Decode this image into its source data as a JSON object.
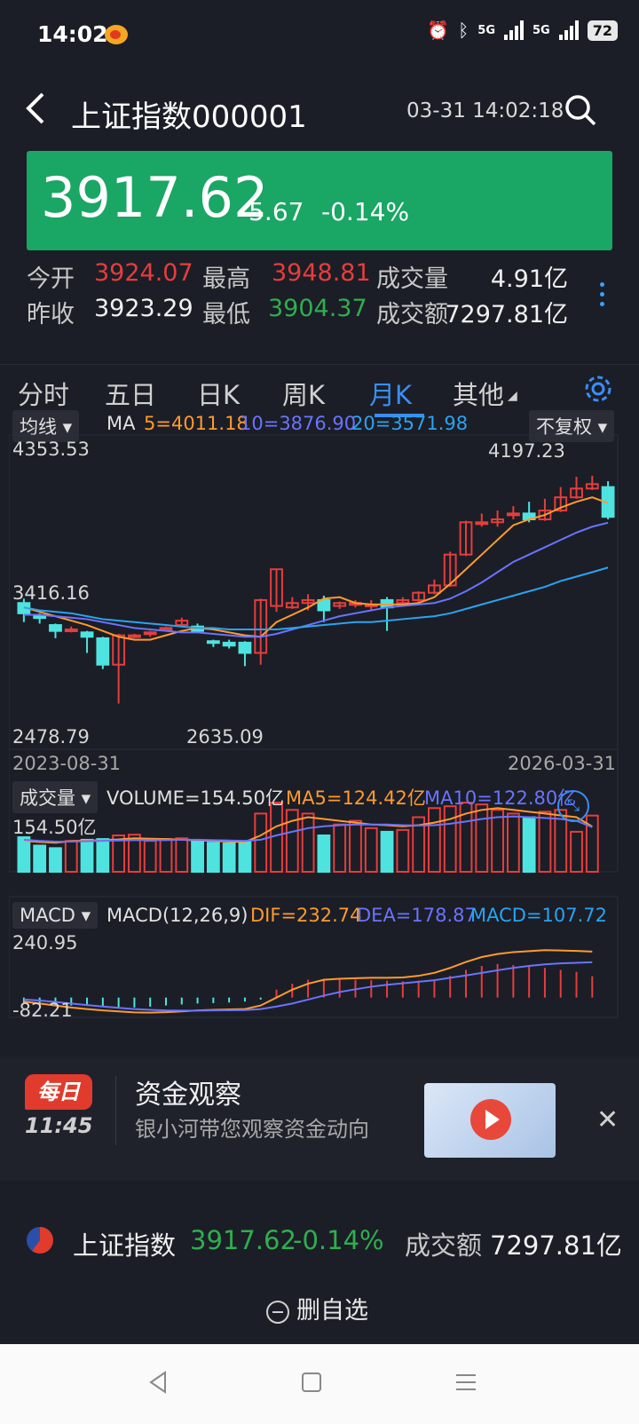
{
  "status": {
    "time": "14:02",
    "battery": "72",
    "net1": "5G",
    "net2": "5G"
  },
  "header": {
    "title": "上证指数000001",
    "datetime": "03-31 14:02:18"
  },
  "price": {
    "last": "3917.62",
    "change": "-5.67",
    "pct": "-0.14%"
  },
  "stats": {
    "open_label": "今开",
    "open": "3924.07",
    "high_label": "最高",
    "high": "3948.81",
    "vol_label": "成交量",
    "vol": "4.91亿",
    "prev_label": "昨收",
    "prev": "3923.29",
    "low_label": "最低",
    "low": "3904.37",
    "amt_label": "成交额",
    "amt": "7297.81亿"
  },
  "tabs": [
    "分时",
    "五日",
    "日K",
    "周K",
    "月K",
    "其他"
  ],
  "kline": {
    "ma_dropdown": "均线",
    "ma_label": "MA",
    "ma5": "5=4011.18",
    "ma10": "10=3876.90",
    "ma20": "20=3571.98",
    "adjust": "不复权",
    "y_top": "4353.53",
    "y_mid": "3416.16",
    "y_bot": "2478.79",
    "max_label": "4197.23",
    "min_label": "2635.09",
    "date_start": "2023-08-31",
    "date_end": "2026-03-31"
  },
  "volume": {
    "dropdown": "成交量",
    "volume": "VOLUME=154.50亿",
    "ma5": "MA5=124.42亿",
    "ma10": "MA10=122.80亿",
    "y_top": "154.50亿"
  },
  "macd": {
    "dropdown": "MACD",
    "params": "MACD(12,26,9)",
    "dif": "DIF=232.74",
    "dea": "DEA=178.87",
    "macd": "MACD=107.72",
    "y_top": "240.95",
    "y_bot": "-82.21"
  },
  "banner": {
    "badge": "每日",
    "time": "11:45",
    "title": "资金观察",
    "subtitle": "银小河带您观察资金动向"
  },
  "quote_bar": {
    "name": "上证指数",
    "price": "3917.62",
    "pct": "-0.14%",
    "amt_label": "成交额",
    "amt": "7297.81亿"
  },
  "action": {
    "label": "删自选"
  },
  "colors": {
    "up": "#e63d3d",
    "down": "#4fe3e0",
    "accent": "#3a8ef5",
    "price_box": "#1aa664",
    "ma5": "#ff9a2e",
    "ma10": "#6a73ff",
    "ma20": "#2ba3f2"
  },
  "chart_data": {
    "type": "candlestick",
    "y_range": [
      2478.79,
      4353.53
    ],
    "candles": [
      {
        "o": 3330,
        "c": 3260,
        "h": 3360,
        "l": 3200
      },
      {
        "o": 3240,
        "c": 3230,
        "h": 3260,
        "l": 3190
      },
      {
        "o": 3180,
        "c": 3140,
        "h": 3190,
        "l": 3090
      },
      {
        "o": 3150,
        "c": 3150,
        "h": 3170,
        "l": 3130
      },
      {
        "o": 3130,
        "c": 3100,
        "h": 3140,
        "l": 2990
      },
      {
        "o": 3090,
        "c": 2910,
        "h": 3100,
        "l": 2880
      },
      {
        "o": 2910,
        "c": 3110,
        "h": 3120,
        "l": 2645
      },
      {
        "o": 3100,
        "c": 3110,
        "h": 3120,
        "l": 3090
      },
      {
        "o": 3120,
        "c": 3130,
        "h": 3140,
        "l": 3100
      },
      {
        "o": 3150,
        "c": 3160,
        "h": 3170,
        "l": 3140
      },
      {
        "o": 3180,
        "c": 3210,
        "h": 3230,
        "l": 3170
      },
      {
        "o": 3170,
        "c": 3140,
        "h": 3190,
        "l": 3130
      },
      {
        "o": 3070,
        "c": 3060,
        "h": 3080,
        "l": 3030
      },
      {
        "o": 3060,
        "c": 3040,
        "h": 3080,
        "l": 3020
      },
      {
        "o": 3060,
        "c": 2990,
        "h": 3070,
        "l": 2900
      },
      {
        "o": 2990,
        "c": 3350,
        "h": 3360,
        "l": 2910
      },
      {
        "o": 3310,
        "c": 3560,
        "h": 3560,
        "l": 3270
      },
      {
        "o": 3300,
        "c": 3330,
        "h": 3370,
        "l": 3290
      },
      {
        "o": 3330,
        "c": 3350,
        "h": 3390,
        "l": 3280
      },
      {
        "o": 3350,
        "c": 3280,
        "h": 3380,
        "l": 3200
      },
      {
        "o": 3310,
        "c": 3330,
        "h": 3340,
        "l": 3290
      },
      {
        "o": 3330,
        "c": 3330,
        "h": 3350,
        "l": 3300
      },
      {
        "o": 3320,
        "c": 3320,
        "h": 3350,
        "l": 3280
      },
      {
        "o": 3350,
        "c": 3300,
        "h": 3370,
        "l": 3140
      },
      {
        "o": 3330,
        "c": 3350,
        "h": 3370,
        "l": 3310
      },
      {
        "o": 3350,
        "c": 3400,
        "h": 3410,
        "l": 3330
      },
      {
        "o": 3400,
        "c": 3450,
        "h": 3490,
        "l": 3390
      },
      {
        "o": 3450,
        "c": 3660,
        "h": 3680,
        "l": 3440
      },
      {
        "o": 3660,
        "c": 3880,
        "h": 3890,
        "l": 3650
      },
      {
        "o": 3870,
        "c": 3880,
        "h": 3940,
        "l": 3850
      },
      {
        "o": 3880,
        "c": 3900,
        "h": 3960,
        "l": 3850
      },
      {
        "o": 3930,
        "c": 3940,
        "h": 3990,
        "l": 3900
      },
      {
        "o": 3940,
        "c": 3900,
        "h": 4020,
        "l": 3880
      },
      {
        "o": 3900,
        "c": 3960,
        "h": 4040,
        "l": 3890
      },
      {
        "o": 3960,
        "c": 4050,
        "h": 4120,
        "l": 3950
      },
      {
        "o": 4050,
        "c": 4110,
        "h": 4190,
        "l": 4040
      },
      {
        "o": 4110,
        "c": 4140,
        "h": 4197,
        "l": 4100
      },
      {
        "o": 4120,
        "c": 3917,
        "h": 4160,
        "l": 3900
      }
    ],
    "ma5": [
      3300,
      3270,
      3240,
      3210,
      3180,
      3140,
      3100,
      3080,
      3080,
      3110,
      3140,
      3160,
      3150,
      3130,
      3110,
      3100,
      3200,
      3250,
      3300,
      3360,
      3370,
      3330,
      3320,
      3320,
      3320,
      3330,
      3370,
      3460,
      3560,
      3660,
      3760,
      3860,
      3900,
      3930,
      3980,
      4020,
      4050,
      4011
    ],
    "ma10": [
      3250,
      3250,
      3240,
      3230,
      3220,
      3200,
      3180,
      3160,
      3150,
      3140,
      3130,
      3130,
      3120,
      3110,
      3100,
      3100,
      3120,
      3150,
      3180,
      3210,
      3240,
      3260,
      3280,
      3300,
      3310,
      3320,
      3330,
      3360,
      3410,
      3470,
      3540,
      3610,
      3660,
      3710,
      3760,
      3810,
      3850,
      3877
    ],
    "ma20": [
      3300,
      3280,
      3270,
      3260,
      3240,
      3220,
      3210,
      3200,
      3190,
      3180,
      3170,
      3160,
      3160,
      3150,
      3150,
      3150,
      3150,
      3160,
      3170,
      3180,
      3190,
      3200,
      3200,
      3210,
      3220,
      3230,
      3240,
      3260,
      3290,
      3320,
      3350,
      3380,
      3410,
      3440,
      3480,
      3510,
      3540,
      3572
    ],
    "volumes": [
      95,
      72,
      65,
      85,
      88,
      90,
      100,
      102,
      85,
      90,
      92,
      86,
      80,
      78,
      82,
      160,
      190,
      170,
      160,
      100,
      130,
      140,
      120,
      110,
      115,
      150,
      175,
      180,
      190,
      185,
      170,
      160,
      150,
      165,
      170,
      110,
      154.5
    ],
    "vol_ma5": [
      85,
      82,
      80,
      84,
      86,
      87,
      89,
      92,
      91,
      90,
      88,
      86,
      85,
      83,
      82,
      100,
      125,
      140,
      150,
      145,
      140,
      135,
      130,
      128,
      125,
      128,
      135,
      145,
      160,
      170,
      175,
      170,
      165,
      160,
      155,
      150,
      124.42
    ],
    "vol_ma10": [
      88,
      85,
      83,
      83,
      84,
      85,
      86,
      87,
      87,
      87,
      88,
      88,
      87,
      86,
      85,
      88,
      100,
      110,
      120,
      125,
      128,
      130,
      130,
      130,
      128,
      127,
      128,
      132,
      138,
      145,
      150,
      152,
      150,
      148,
      145,
      140,
      122.8
    ],
    "macd_hist": [
      -30,
      -35,
      -38,
      -40,
      -42,
      -44,
      -48,
      -50,
      -46,
      -40,
      -35,
      -30,
      -28,
      -25,
      -20,
      -10,
      40,
      70,
      90,
      95,
      92,
      90,
      88,
      85,
      82,
      86,
      90,
      110,
      140,
      160,
      170,
      165,
      160,
      150,
      140,
      130,
      107.72
    ],
    "dif": [
      -20,
      -30,
      -40,
      -50,
      -58,
      -65,
      -70,
      -75,
      -76,
      -74,
      -70,
      -65,
      -62,
      -60,
      -58,
      -40,
      0,
      40,
      70,
      90,
      95,
      98,
      100,
      100,
      102,
      110,
      125,
      150,
      180,
      205,
      220,
      230,
      235,
      240,
      238,
      236,
      232.74
    ],
    "dea": [
      -10,
      -15,
      -22,
      -30,
      -38,
      -45,
      -52,
      -58,
      -62,
      -65,
      -66,
      -66,
      -65,
      -64,
      -63,
      -58,
      -45,
      -30,
      -10,
      10,
      28,
      42,
      55,
      65,
      72,
      80,
      88,
      100,
      112,
      125,
      138,
      150,
      160,
      168,
      173,
      176,
      178.87
    ],
    "macd_range": [
      -82.21,
      240.95
    ]
  }
}
